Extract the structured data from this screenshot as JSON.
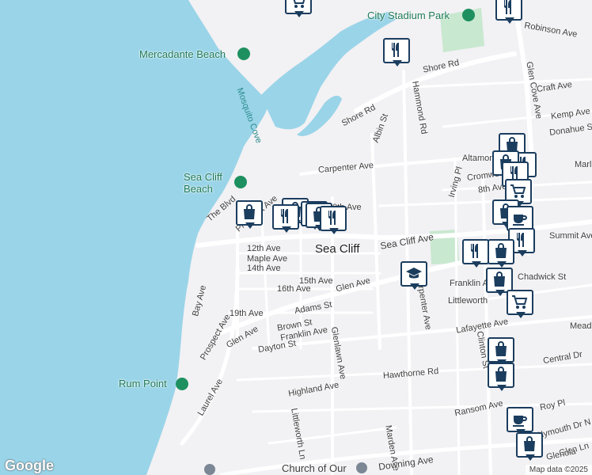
{
  "map": {
    "town_label": "Sea Cliff",
    "attribution": "Map data ©2025",
    "logo": "Google",
    "colors": {
      "water": "#9ad4e8",
      "land": "#f2f1f4",
      "park": "#c8e8cf",
      "road": "#ffffff",
      "pin_border": "#1b3d5e"
    },
    "parks": [
      {
        "name": "City Stadium Park"
      },
      {
        "name": "Mercadante Beach"
      },
      {
        "name": "Sea Cliff Beach"
      },
      {
        "name": "Rum Point"
      }
    ],
    "water_labels": [
      {
        "name": "Mosquito Cove"
      }
    ],
    "streets": [
      "Robinson Ave",
      "Glen Cove Ave",
      "Shore Rd",
      "Craft Ave",
      "Hammond Rd",
      "Shore Rd",
      "Albin St",
      "Kemp Ave",
      "Donahue St",
      "Altamont",
      "Carpenter Ave",
      "Irving Pl",
      "Cromwell",
      "Marl",
      "8th Ave",
      "The Blvd",
      "Prospect Ave",
      "10th Ave",
      "Sea Cliff Ave",
      "Summit Ave",
      "12th Ave",
      "Maple Ave",
      "14th Ave",
      "15th Ave",
      "16th Ave",
      "Glen Ave",
      "Franklin Ave",
      "Chadwick St",
      "Littleworth",
      "Bay Ave",
      "19th Ave",
      "Adams St",
      "Brown St",
      "Franklin Ave",
      "Glen Ave",
      "Carpenter Ave",
      "Lafayette Ave",
      "Clinton St",
      "Meado",
      "Dayton St",
      "Prospect Ave",
      "Glenlawn Ave",
      "Central Dr",
      "Hawthorne Rd",
      "Laurel Ave",
      "Highland Ave",
      "Ransom Ave",
      "Roy Pl",
      "Littleworth Ln",
      "Marden Ave",
      "Plymouth Dr N",
      "Glen Ln",
      "Downing Ave",
      "Glenola",
      "Church of Our"
    ],
    "markers": [
      {
        "icon": "cart-icon"
      },
      {
        "icon": "restaurant-icon"
      },
      {
        "icon": "restaurant-icon"
      },
      {
        "icon": "shopping-bag-icon"
      },
      {
        "icon": "shopping-bag-icon"
      },
      {
        "icon": "restaurant-icon"
      },
      {
        "icon": "cart-icon"
      },
      {
        "icon": "shopping-bag-icon"
      },
      {
        "icon": "restaurant-icon"
      },
      {
        "icon": "shopping-bag-icon"
      },
      {
        "icon": "restaurant-icon"
      },
      {
        "icon": "shopping-bag-icon"
      },
      {
        "icon": "restaurant-icon"
      },
      {
        "icon": "cart-icon"
      },
      {
        "icon": "shopping-bag-icon"
      },
      {
        "icon": "coffee-icon"
      },
      {
        "icon": "restaurant-icon"
      },
      {
        "icon": "restaurant-icon"
      },
      {
        "icon": "school-icon"
      },
      {
        "icon": "shopping-bag-icon"
      },
      {
        "icon": "shopping-bag-icon"
      },
      {
        "icon": "cart-icon"
      },
      {
        "icon": "shopping-bag-icon"
      },
      {
        "icon": "shopping-bag-icon"
      },
      {
        "icon": "coffee-icon"
      },
      {
        "icon": "shopping-bag-icon"
      }
    ]
  }
}
